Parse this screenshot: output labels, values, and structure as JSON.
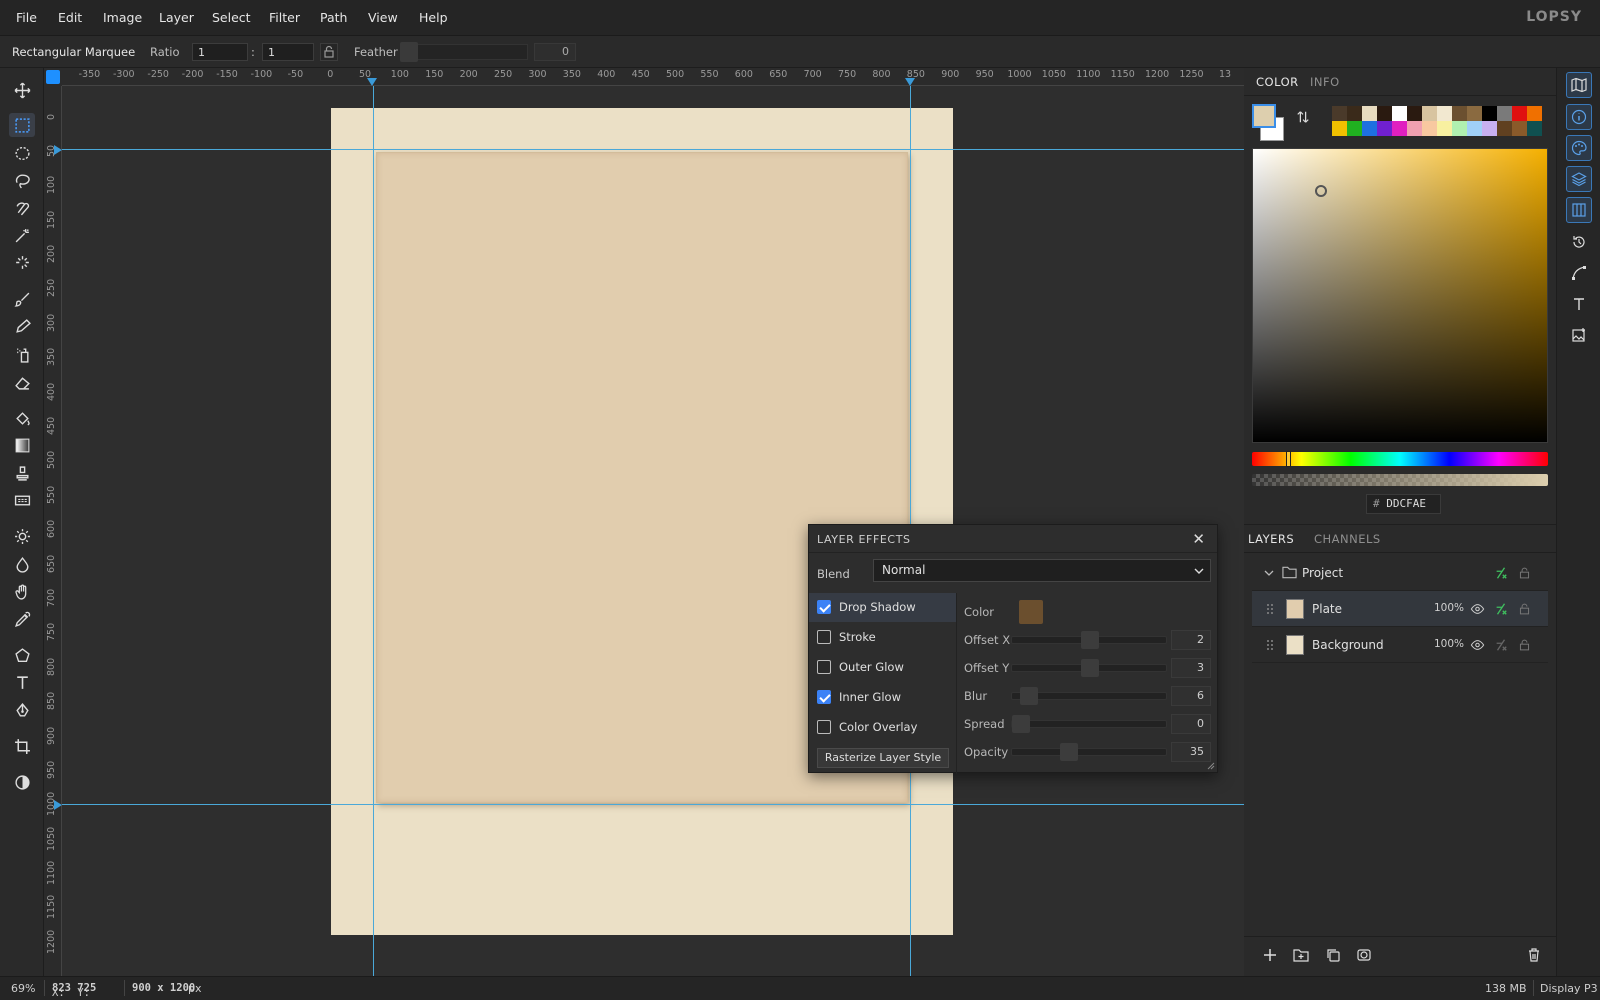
{
  "app": {
    "brand": "LOPSY"
  },
  "menu": [
    "File",
    "Edit",
    "Image",
    "Layer",
    "Select",
    "Filter",
    "Path",
    "View",
    "Help"
  ],
  "options": {
    "tool_name": "Rectangular Marquee",
    "ratio_label": "Ratio",
    "ratio_w": "1",
    "ratio_sep": ":",
    "ratio_h": "1",
    "feather_label": "Feather",
    "feather_value": "0"
  },
  "rulers": {
    "top": [
      "-350",
      "-300",
      "-250",
      "-200",
      "-150",
      "-100",
      "-50",
      "0",
      "50",
      "100",
      "150",
      "200",
      "250",
      "300",
      "350",
      "400",
      "450",
      "500",
      "550",
      "600",
      "650",
      "700",
      "750",
      "800",
      "850",
      "900",
      "950",
      "1000",
      "1050",
      "1100",
      "1150",
      "1200",
      "1250",
      "13"
    ],
    "left": [
      "0",
      "50",
      "100",
      "150",
      "200",
      "250",
      "300",
      "350",
      "400",
      "450",
      "500",
      "550",
      "600",
      "650",
      "700",
      "750",
      "800",
      "850",
      "900",
      "950",
      "1000",
      "1050",
      "1100",
      "1150",
      "1200"
    ]
  },
  "color_panel": {
    "tabs": [
      "COLOR",
      "INFO"
    ],
    "hex_prefix": "#",
    "hex": "DDCFAE",
    "foreground": "#ddcfae",
    "background": "#ffffff",
    "swatches": [
      "#4a3a2a",
      "#3a2a1a",
      "#e8dcc0",
      "#2a1a10",
      "#ffffff",
      "#2a1a10",
      "#d8c4a0",
      "#f2e8d0",
      "#6b5030",
      "#8a6a40",
      "#000000",
      "#7a7a7a",
      "#e01010",
      "#f07000",
      "#f0c000",
      "#20b020",
      "#1e70e0",
      "#7020d0",
      "#e020c0",
      "#f0a0b0",
      "#f8c8a0",
      "#f8f0a0",
      "#b0f0b0",
      "#a0d0f8",
      "#c8b0f0",
      "#604020",
      "#8a5a2a",
      "#105050"
    ]
  },
  "layers_panel": {
    "tabs": [
      "LAYERS",
      "CHANNELS"
    ],
    "group": {
      "name": "Project"
    },
    "layers": [
      {
        "name": "Plate",
        "opacity": "100%",
        "thumb": "#e1cdae"
      },
      {
        "name": "Background",
        "opacity": "100%",
        "thumb": "#ebe0c6"
      }
    ]
  },
  "layer_effects": {
    "title": "LAYER EFFECTS",
    "blend_label": "Blend",
    "blend_value": "Normal",
    "effects": [
      {
        "label": "Drop Shadow",
        "checked": true
      },
      {
        "label": "Stroke",
        "checked": false
      },
      {
        "label": "Outer Glow",
        "checked": false
      },
      {
        "label": "Inner Glow",
        "checked": true
      },
      {
        "label": "Color Overlay",
        "checked": false
      }
    ],
    "rasterize_label": "Rasterize Layer Style",
    "color_label": "Color",
    "shadow_color": "#6b4f2e",
    "props": [
      {
        "label": "Offset X",
        "value": "2",
        "level": 0.5
      },
      {
        "label": "Offset Y",
        "value": "3",
        "level": 0.5
      },
      {
        "label": "Blur",
        "value": "6",
        "level": 0.06
      },
      {
        "label": "Spread",
        "value": "0",
        "level": 0
      },
      {
        "label": "Opacity",
        "value": "35",
        "level": 0.35
      }
    ]
  },
  "status": {
    "zoom": "69%",
    "coords_x_label": "X:",
    "coords_x": "823",
    "coords_y_label": "Y:",
    "coords_y": "725",
    "doc_size": "900 x 1200",
    "doc_unit": "px",
    "memory": "138 MB",
    "profile": "Display P3"
  }
}
